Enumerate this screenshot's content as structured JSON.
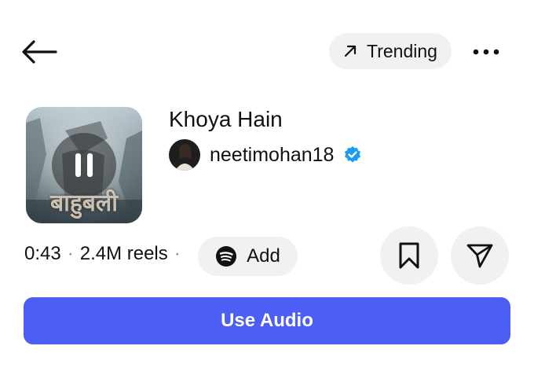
{
  "header": {
    "back_icon": "arrow-left-icon",
    "trending_label": "Trending",
    "trending_icon": "arrow-up-right-icon",
    "more_icon": "ellipsis-icon"
  },
  "track": {
    "cover_text": "बाहुबली",
    "cover_state_icon": "pause-icon",
    "title": "Khoya Hain",
    "artist": "neetimohan18",
    "verified_icon": "verified-badge-icon",
    "duration": "0:43",
    "reels": "2.4M reels",
    "separator": "·"
  },
  "actions": {
    "add_label": "Add",
    "add_icon": "spotify-icon",
    "save_icon": "bookmark-icon",
    "share_icon": "send-icon",
    "use_audio_label": "Use Audio"
  },
  "colors": {
    "accent": "#4c5ef3",
    "pill_bg": "#eff1f3",
    "verified": "#1d9bf0",
    "text": "#111111"
  }
}
